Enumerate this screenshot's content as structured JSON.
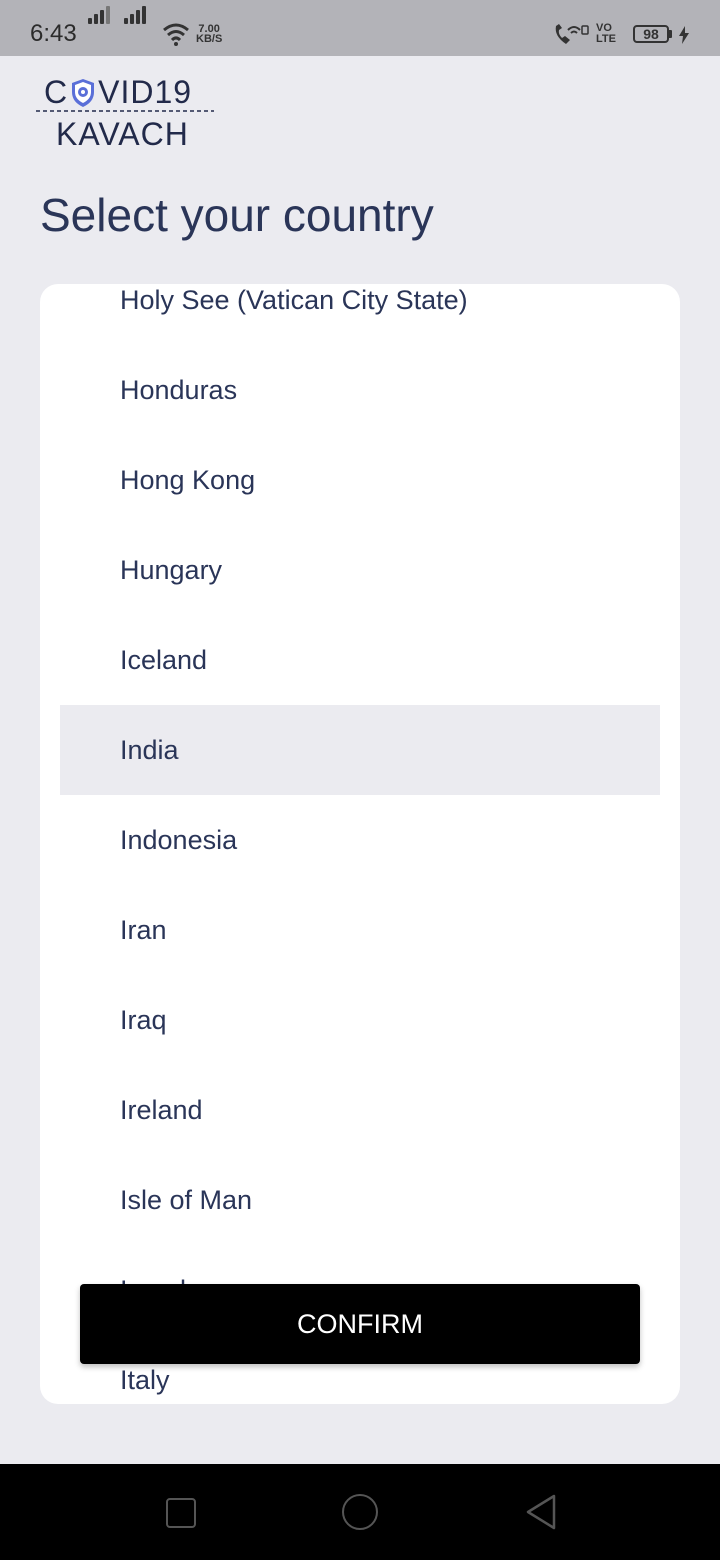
{
  "status_bar": {
    "time": "6:43",
    "speed_value": "7.00",
    "speed_unit": "KB/S",
    "volte_top": "VO",
    "volte_bottom": "LTE",
    "battery": "98"
  },
  "logo": {
    "line1_left": "C",
    "line1_right": "VID19",
    "line2": "KAVACH"
  },
  "page": {
    "title": "Select your country"
  },
  "countries": [
    {
      "label": "Holy See (Vatican City State)",
      "selected": false
    },
    {
      "label": "Honduras",
      "selected": false
    },
    {
      "label": "Hong Kong",
      "selected": false
    },
    {
      "label": "Hungary",
      "selected": false
    },
    {
      "label": "Iceland",
      "selected": false
    },
    {
      "label": "India",
      "selected": true
    },
    {
      "label": "Indonesia",
      "selected": false
    },
    {
      "label": "Iran",
      "selected": false
    },
    {
      "label": "Iraq",
      "selected": false
    },
    {
      "label": "Ireland",
      "selected": false
    },
    {
      "label": "Isle of Man",
      "selected": false
    },
    {
      "label": "Israel",
      "selected": false
    },
    {
      "label": "Italy",
      "selected": false
    }
  ],
  "confirm_label": "CONFIRM",
  "colors": {
    "background": "#ebebf0",
    "text": "#2a3558",
    "selected_row": "#ebebf0",
    "button": "#000000"
  }
}
